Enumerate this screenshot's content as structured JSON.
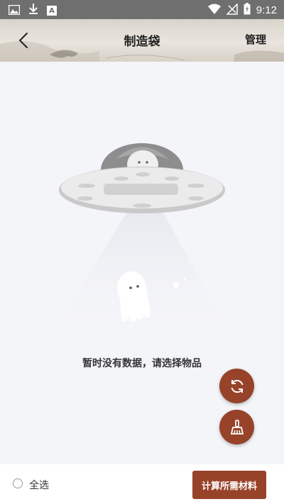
{
  "status_bar": {
    "time": "9:12",
    "icons": [
      "image-icon",
      "download-icon",
      "a-letter-icon",
      "wifi-icon",
      "no-signal-icon",
      "battery-charging-icon"
    ],
    "a_icon_letter": "A"
  },
  "header": {
    "title": "制造袋",
    "manage_label": "管理"
  },
  "empty_state": {
    "message": "暂时没有数据，请选择物品"
  },
  "fabs": {
    "refresh_icon": "refresh-icon",
    "clean_icon": "broom-icon"
  },
  "footer": {
    "select_all_label": "全选",
    "calculate_button_label": "计算所需材料"
  },
  "colors": {
    "accent": "#97432a",
    "status_bar": "#6f6f6f",
    "background": "#f4f5f9"
  }
}
